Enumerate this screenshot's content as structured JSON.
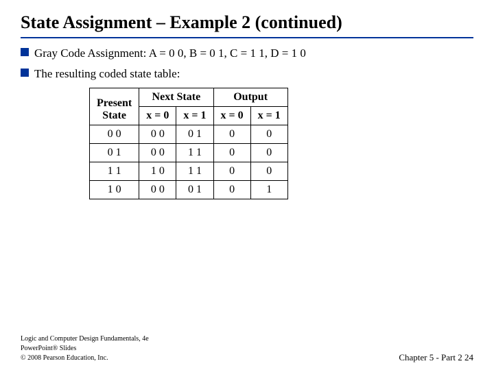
{
  "slide": {
    "title": "State Assignment – Example 2 (continued)",
    "bullets": [
      {
        "id": "bullet1",
        "text": "Gray Code Assignment: A = 0 0, B = 0 1, C = 1 1, D = 1 0"
      },
      {
        "id": "bullet2",
        "text": "The resulting coded state table:"
      }
    ],
    "table": {
      "headers": {
        "present_state": "Present State",
        "next_state": "Next State",
        "next_state_x0": "x = 0",
        "next_state_x1": "x = 1",
        "output": "Output",
        "output_x0": "x = 0",
        "output_x1": "x = 1"
      },
      "rows": [
        {
          "ps": "0 0",
          "ns0": "0 0",
          "ns1": "0 1",
          "out0": "0",
          "out1": "0"
        },
        {
          "ps": "0 1",
          "ns0": "0 0",
          "ns1": "1 1",
          "out0": "0",
          "out1": "0"
        },
        {
          "ps": "1 1",
          "ns0": "1 0",
          "ns1": "1 1",
          "out0": "0",
          "out1": "0"
        },
        {
          "ps": "1 0",
          "ns0": "0 0",
          "ns1": "0 1",
          "out0": "0",
          "out1": "1"
        }
      ]
    },
    "footer": {
      "book": "Logic and Computer Design Fundamentals, 4e",
      "publisher": "PowerPoint® Slides",
      "copyright": "© 2008 Pearson Education, Inc.",
      "chapter": "Chapter 5 - Part 2  24"
    }
  }
}
